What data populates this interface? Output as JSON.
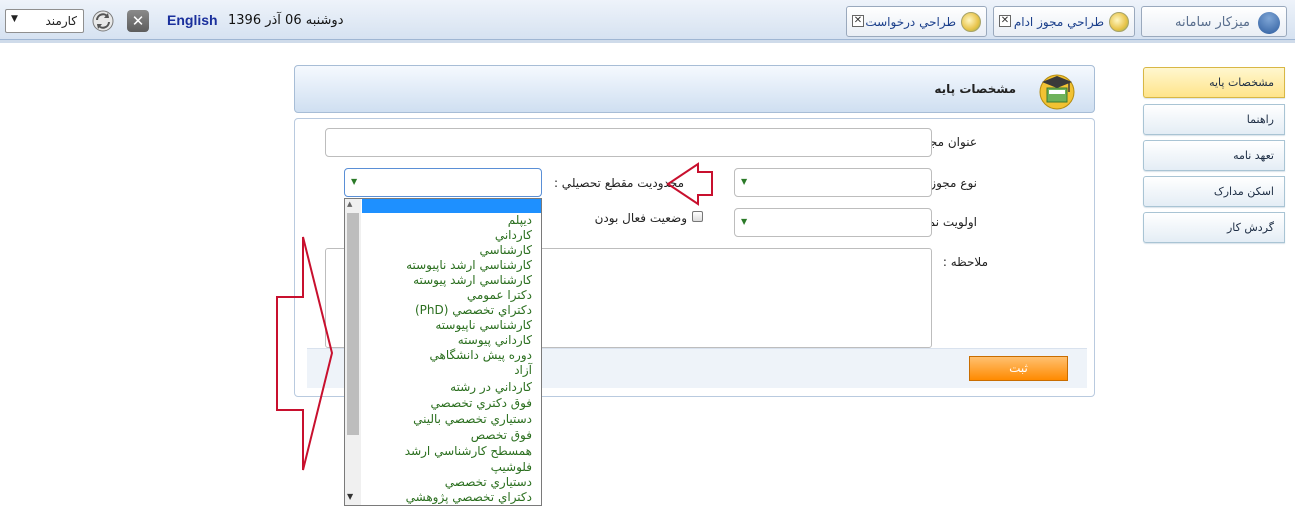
{
  "topbar": {
    "role_value": "کارمند",
    "lang_link": "English",
    "date_text": "دوشنبه 06 آذر 1396",
    "tabs": [
      {
        "label": "طراحي درخواست",
        "icon": "form-icon"
      },
      {
        "label": "طراحي مجوز ادام",
        "icon": "form-icon"
      }
    ],
    "home_tab": "ميزكار سامانه"
  },
  "sidebar": {
    "items": [
      {
        "label": "مشخصات پايه",
        "active": true
      },
      {
        "label": "راهنما",
        "active": false
      },
      {
        "label": "تعهد نامه",
        "active": false
      },
      {
        "label": "اسکن مدارک",
        "active": false
      },
      {
        "label": "گردش کار",
        "active": false
      }
    ]
  },
  "panel": {
    "title": "مشخصات پايه",
    "fields": {
      "license_title": "عنوان مجوز :",
      "license_type": "نوع مجوز :",
      "education_limit": "محدوديت مقطع تحصيلي :",
      "display_priority": "اولويت نمايش :",
      "active_status": "وضعيت فعال بودن",
      "note": "ملاحظه :"
    },
    "submit_label": "ثبت"
  },
  "dropdown": {
    "selected_value": "",
    "options": [
      "ديپلم",
      "كارداني",
      "كارشناسي",
      "كارشناسي ارشد ناپيوسته",
      "كارشناسي ارشد پيوسته",
      "دكترا عمومي",
      "دكتراي تخصصي (PhD)",
      "كارشناسي ناپيوسته",
      "كارداني پيوسته",
      "دوره پيش دانشگاهي",
      "آزاد",
      "كارداني در رشته",
      "فوق دكتري تخصصي",
      "دستياري تخصصي باليني",
      "فوق تخصص",
      "همسطح كارشناسي ارشد",
      "فلوشيپ",
      "دستياري تخصصي",
      "دكتراي تخصصي پژوهشي"
    ]
  },
  "colors": {
    "accent_orange": "#ff8a00",
    "option_green": "#2b6f1f",
    "annotation_red": "#c8102e",
    "selection_blue": "#1e90ff"
  }
}
